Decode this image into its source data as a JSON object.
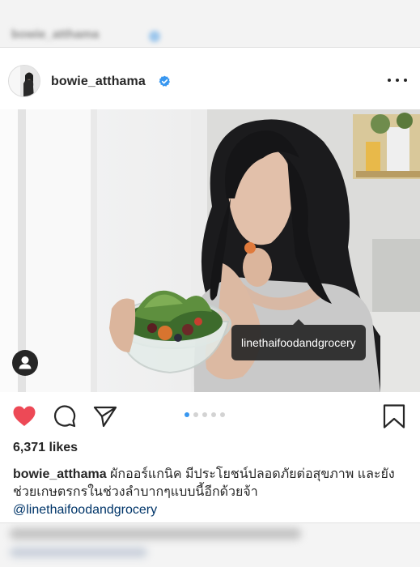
{
  "background_post": {
    "username": "bowie_atthama"
  },
  "post": {
    "header": {
      "username": "bowie_atthama",
      "verified": true,
      "avatar_icon": "profile-avatar",
      "more_icon": "more-options-icon"
    },
    "photo": {
      "tag_label": "linethaifoodandgrocery",
      "user_tag_icon": "person-icon"
    },
    "actions": {
      "like_icon": "heart-filled-icon",
      "comment_icon": "comment-icon",
      "share_icon": "share-icon",
      "save_icon": "bookmark-icon",
      "carousel_total": 5,
      "carousel_active": 1,
      "liked_color": "#ed4956",
      "accent_color": "#3897f0"
    },
    "likes": "6,371 likes",
    "caption": {
      "username": "bowie_atthama",
      "text": "ผักออร์แกนิค มีประโยชน์ปลอดภัยต่อสุขภาพ และยังช่วยเกษตรกรในช่วงลำบากๆแบบนี้อีกด้วยจ้า",
      "mention": "@linethaifoodandgrocery"
    }
  }
}
